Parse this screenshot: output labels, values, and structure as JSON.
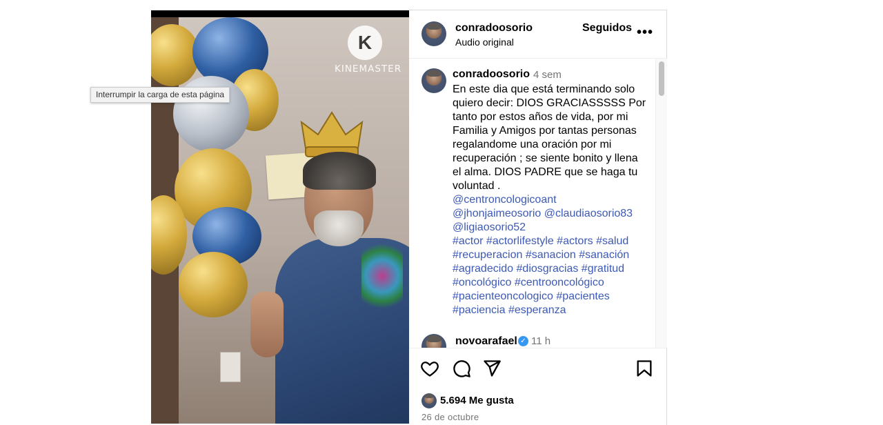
{
  "media": {
    "watermark": "KINEMASTER",
    "watermark_logo_letter": "K"
  },
  "tooltip": "Interrumpir la carga de esta página",
  "header": {
    "username": "conradoosorio",
    "subtitle": "Audio original",
    "follow_label": "Seguidos",
    "more_label": "•••"
  },
  "caption": {
    "username": "conradoosorio",
    "time": "4 sem",
    "lines": [
      "En este dia que está terminando solo",
      "quiero decir:  DIOS GRACIASSSSS Por",
      "tanto por estos años de vida, por mi",
      "Familia y Amigos por tantas personas",
      "regalandome una oración por mi",
      "recuperación ; se siente bonito y llena",
      "el alma. DIOS PADRE que se haga tu",
      "voluntad ."
    ],
    "tags": [
      "@centroncologicoant",
      "@jhonjaimeosorio @claudiaosorio83",
      "@ligiaosorio52",
      "#actor #actorlifestyle #actors #salud",
      "#recuperacion #sanacion #sanación",
      "#agradecido #diosgracias #gratitud",
      "#oncológico #centrooncológico",
      "#pacienteoncologico #pacientes",
      "#paciencia #esperanza"
    ]
  },
  "comment2": {
    "username": "novoarafael",
    "time": "11 h"
  },
  "actions": {
    "likes": "5.694 Me gusta",
    "date": "26 de octubre"
  }
}
